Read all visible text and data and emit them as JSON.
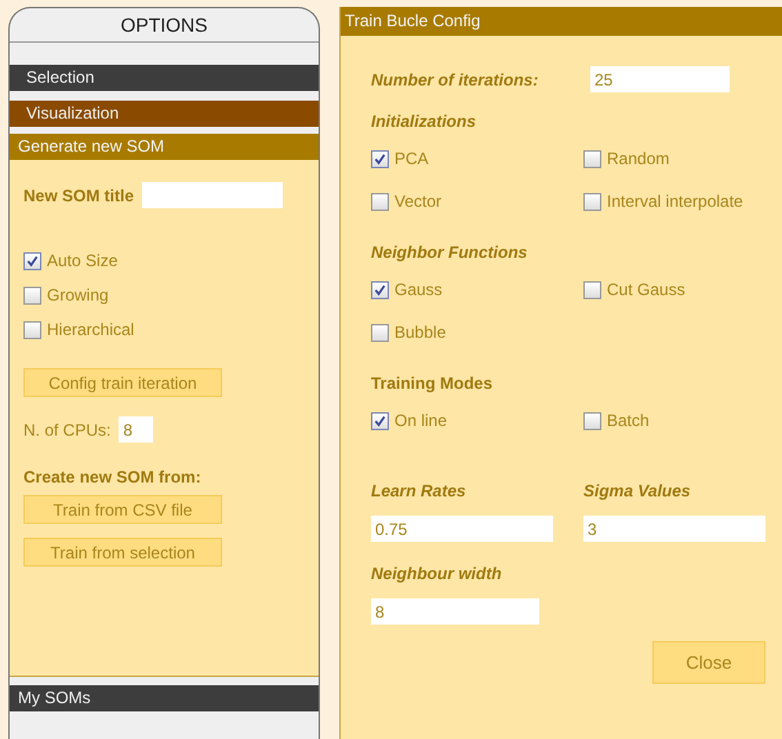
{
  "options_panel": {
    "title": "OPTIONS",
    "sections": [
      {
        "label": "Selection",
        "kind": "dark"
      },
      {
        "label": "Visualization",
        "kind": "brown"
      },
      {
        "label": "Generate new SOM",
        "kind": "gold"
      }
    ],
    "som_title": {
      "label": "New SOM title"
    },
    "checkboxes": [
      {
        "label": "Auto Size",
        "checked": true
      },
      {
        "label": "Growing",
        "checked": false
      },
      {
        "label": "Hierarchical",
        "checked": false
      }
    ],
    "config_button": "Config train iteration",
    "cpus": {
      "label": "N. of CPUs:",
      "value": "8"
    },
    "create_heading": "Create new SOM from:",
    "train_buttons": [
      "Train from CSV file",
      "Train from selection"
    ],
    "my_soms": "My SOMs"
  },
  "dialog": {
    "title": "Train Bucle Config",
    "iterations": {
      "label": "Number of iterations:",
      "value": "25"
    },
    "groups": [
      {
        "heading": "Initializations",
        "italic": true,
        "options": [
          {
            "label": "PCA",
            "checked": true
          },
          {
            "label": "Random",
            "checked": false
          },
          {
            "label": "Vector",
            "checked": false
          },
          {
            "label": "Interval interpolate",
            "checked": false
          }
        ]
      },
      {
        "heading": "Neighbor Functions",
        "italic": true,
        "options": [
          {
            "label": "Gauss",
            "checked": true
          },
          {
            "label": "Cut Gauss",
            "checked": false
          },
          {
            "label": "Bubble",
            "checked": false
          }
        ]
      },
      {
        "heading": "Training Modes",
        "italic": false,
        "options": [
          {
            "label": "On line",
            "checked": true
          },
          {
            "label": "Batch",
            "checked": false
          }
        ]
      }
    ],
    "learn_rates": {
      "label": "Learn Rates",
      "value": "0.75"
    },
    "sigma_values": {
      "label": "Sigma Values",
      "value": "3"
    },
    "neighbour_width": {
      "label": "Neighbour width",
      "value": "8"
    },
    "close_button": "Close"
  }
}
